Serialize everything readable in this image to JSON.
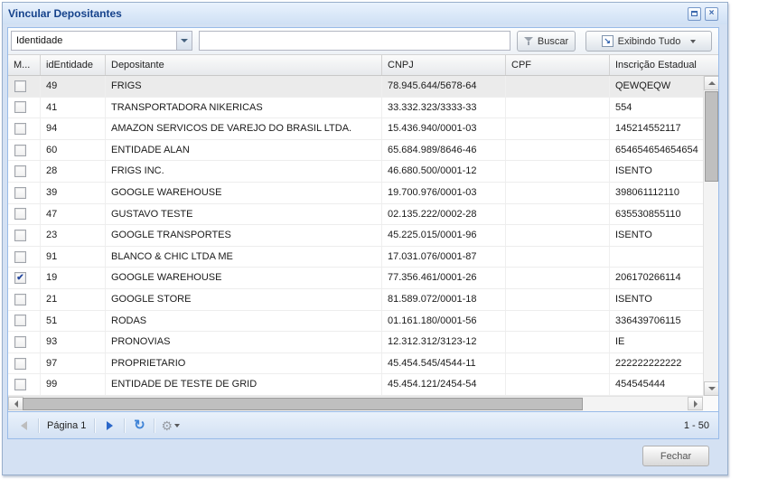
{
  "window": {
    "title": "Vincular Depositantes"
  },
  "icons": {
    "close": "×",
    "show_all_arrow": "↘",
    "refresh": "↻",
    "gear": "⚙",
    "check": "✔"
  },
  "toolbar": {
    "filter_combo": {
      "value": "Identidade"
    },
    "search_input": {
      "value": "",
      "placeholder": ""
    },
    "buscar_button": {
      "label": "Buscar",
      "icon": "filter-funnel-icon"
    },
    "exibindo_button": {
      "label": "Exibindo Tudo",
      "icon": "show-all-icon"
    }
  },
  "grid": {
    "columns": [
      {
        "label": "M..."
      },
      {
        "label": "idEntidade"
      },
      {
        "label": "Depositante"
      },
      {
        "label": "CNPJ"
      },
      {
        "label": "CPF"
      },
      {
        "label": "Inscrição Estadual"
      }
    ],
    "rows": [
      {
        "checked": false,
        "highlighted": true,
        "idEntidade": "49",
        "depositante": "FRIGS",
        "cnpj": "78.945.644/5678-64",
        "cpf": "",
        "inscricao_estadual": "QEWQEQW"
      },
      {
        "checked": false,
        "highlighted": false,
        "idEntidade": "41",
        "depositante": "TRANSPORTADORA NIKERICAS",
        "cnpj": "33.332.323/3333-33",
        "cpf": "",
        "inscricao_estadual": "554"
      },
      {
        "checked": false,
        "highlighted": false,
        "idEntidade": "94",
        "depositante": "AMAZON SERVICOS DE VAREJO DO BRASIL LTDA.",
        "cnpj": "15.436.940/0001-03",
        "cpf": "",
        "inscricao_estadual": "145214552117"
      },
      {
        "checked": false,
        "highlighted": false,
        "idEntidade": "60",
        "depositante": "ENTIDADE ALAN",
        "cnpj": "65.684.989/8646-46",
        "cpf": "",
        "inscricao_estadual": "654654654654654"
      },
      {
        "checked": false,
        "highlighted": false,
        "idEntidade": "28",
        "depositante": "FRIGS INC.",
        "cnpj": "46.680.500/0001-12",
        "cpf": "",
        "inscricao_estadual": "ISENTO"
      },
      {
        "checked": false,
        "highlighted": false,
        "idEntidade": "39",
        "depositante": "GOOGLE WAREHOUSE",
        "cnpj": "19.700.976/0001-03",
        "cpf": "",
        "inscricao_estadual": "398061112110"
      },
      {
        "checked": false,
        "highlighted": false,
        "idEntidade": "47",
        "depositante": "GUSTAVO TESTE",
        "cnpj": "02.135.222/0002-28",
        "cpf": "",
        "inscricao_estadual": "635530855110"
      },
      {
        "checked": false,
        "highlighted": false,
        "idEntidade": "23",
        "depositante": "GOOGLE TRANSPORTES",
        "cnpj": "45.225.015/0001-96",
        "cpf": "",
        "inscricao_estadual": "ISENTO"
      },
      {
        "checked": false,
        "highlighted": false,
        "idEntidade": "91",
        "depositante": "BLANCO & CHIC LTDA ME",
        "cnpj": "17.031.076/0001-87",
        "cpf": "",
        "inscricao_estadual": ""
      },
      {
        "checked": true,
        "highlighted": false,
        "idEntidade": "19",
        "depositante": "GOOGLE WAREHOUSE",
        "cnpj": "77.356.461/0001-26",
        "cpf": "",
        "inscricao_estadual": "206170266114"
      },
      {
        "checked": false,
        "highlighted": false,
        "idEntidade": "21",
        "depositante": "GOOGLE STORE",
        "cnpj": "81.589.072/0001-18",
        "cpf": "",
        "inscricao_estadual": "ISENTO"
      },
      {
        "checked": false,
        "highlighted": false,
        "idEntidade": "51",
        "depositante": "RODAS",
        "cnpj": "01.161.180/0001-56",
        "cpf": "",
        "inscricao_estadual": "336439706115"
      },
      {
        "checked": false,
        "highlighted": false,
        "idEntidade": "93",
        "depositante": "PRONOVIAS",
        "cnpj": "12.312.312/3123-12",
        "cpf": "",
        "inscricao_estadual": "IE"
      },
      {
        "checked": false,
        "highlighted": false,
        "idEntidade": "97",
        "depositante": "PROPRIETARIO",
        "cnpj": "45.454.545/4544-11",
        "cpf": "",
        "inscricao_estadual": "222222222222"
      },
      {
        "checked": false,
        "highlighted": false,
        "idEntidade": "99",
        "depositante": "ENTIDADE DE TESTE DE GRID",
        "cnpj": "45.454.121/2454-54",
        "cpf": "",
        "inscricao_estadual": "454545444"
      }
    ]
  },
  "paging": {
    "page_label": "Página 1",
    "range_label": "1 - 50"
  },
  "footer": {
    "fechar_label": "Fechar"
  },
  "colors": {
    "title_text": "#15428b",
    "window_chrome": "#d4e1f3",
    "panel_border": "#99bbe8",
    "checkmark": "#24479d",
    "next_arrow": "#2b67c9"
  }
}
